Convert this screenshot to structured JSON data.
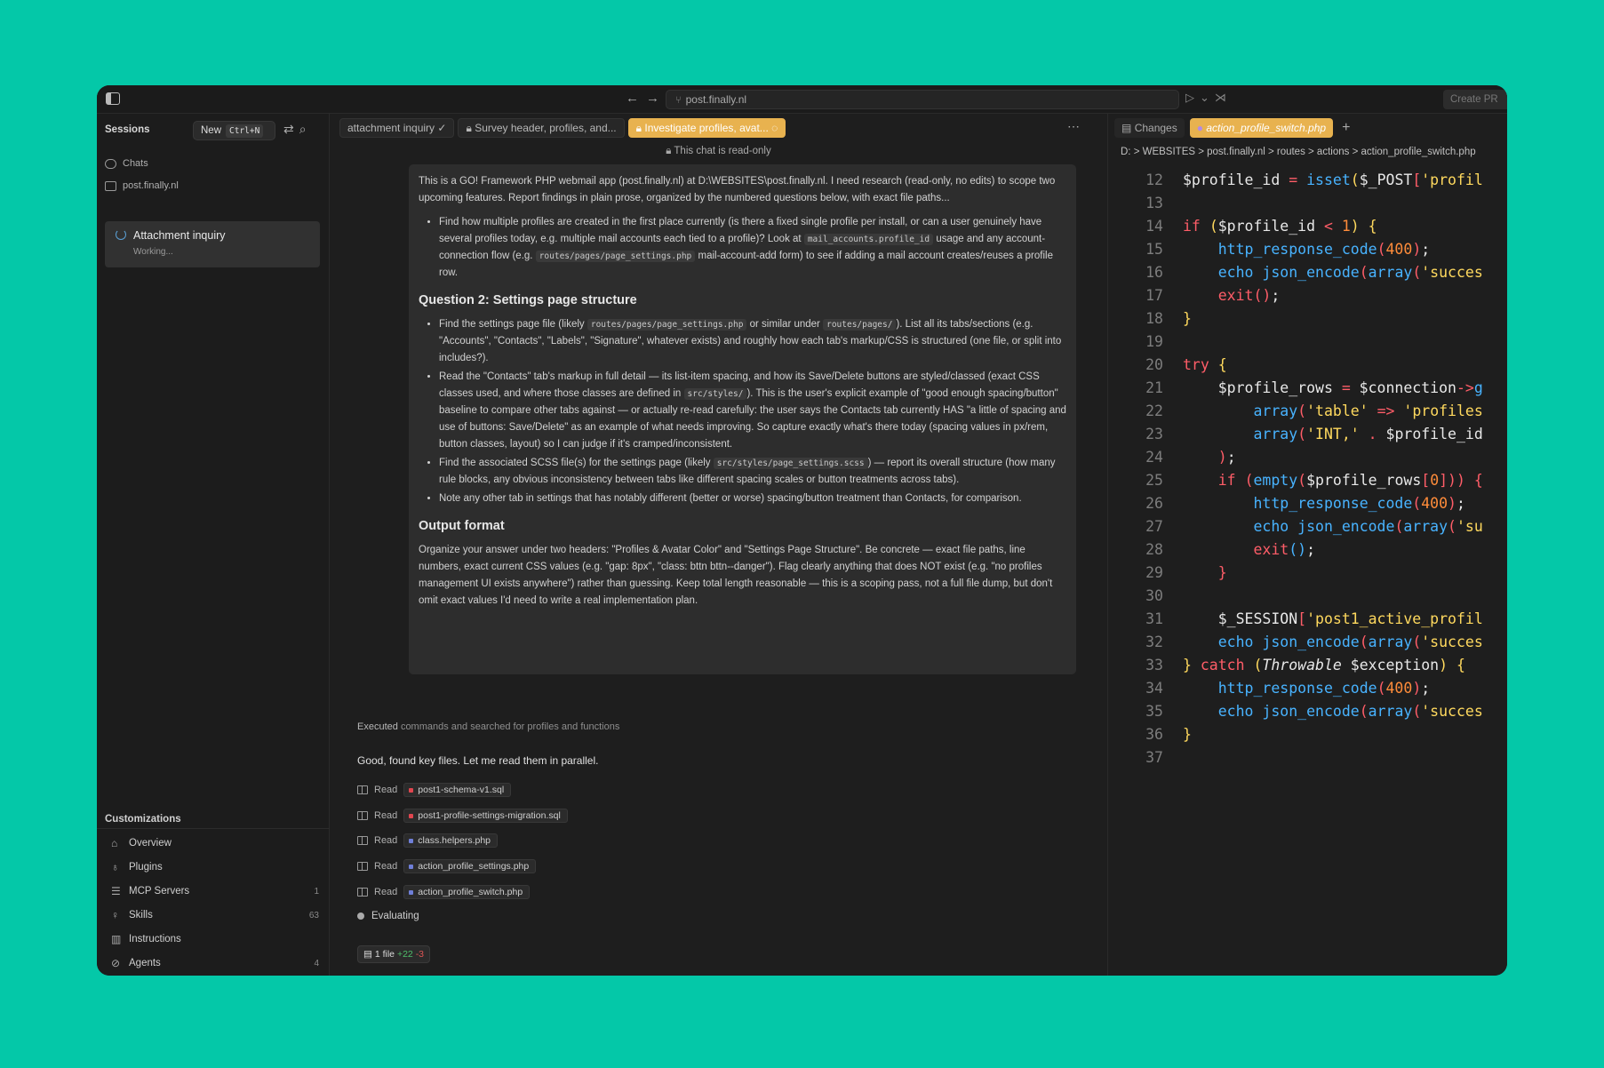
{
  "titlebar": {
    "url": "post.finally.nl",
    "create_pr": "Create PR"
  },
  "sidebar": {
    "title": "Sessions",
    "new_label": "New",
    "new_shortcut": "Ctrl+N",
    "chats": "Chats",
    "folder": "post.finally.nl",
    "session": {
      "title": "Attachment inquiry",
      "status": "Working..."
    },
    "customizations_title": "Customizations",
    "customizations": [
      {
        "label": "Overview",
        "icon": "home-icon",
        "count": ""
      },
      {
        "label": "Plugins",
        "icon": "plug-icon",
        "count": ""
      },
      {
        "label": "MCP Servers",
        "icon": "server-icon",
        "count": "1"
      },
      {
        "label": "Skills",
        "icon": "bulb-icon",
        "count": "63"
      },
      {
        "label": "Instructions",
        "icon": "book-icon",
        "count": ""
      },
      {
        "label": "Agents",
        "icon": "agent-icon",
        "count": "4"
      }
    ]
  },
  "chat": {
    "tabs": [
      "attachment inquiry",
      "Survey header, profiles, and...",
      "Investigate profiles, avat..."
    ],
    "readonly": "This chat is read-only",
    "intro": "This is a GO! Framework PHP webmail app (post.finally.nl) at D:\\WEBSITES\\post.finally.nl. I need research (read-only, no edits) to scope two upcoming features. Report findings in plain prose, organized by the numbered questions below, with exact file paths...",
    "q1_b1_a": "Find how multiple profiles are created in the first place currently (is there a fixed single profile per install, or can a user genuinely have several profiles today, e.g. multiple mail accounts each tied to a profile)? Look at",
    "q1_b1_code1": "mail_accounts.profile_id",
    "q1_b1_b": "usage and any account-connection flow (e.g.",
    "q1_b1_code2": "routes/pages/page_settings.php",
    "q1_b1_c": "mail-account-add form) to see if adding a mail account creates/reuses a profile row.",
    "q2_title": "Question 2: Settings page structure",
    "q2_b1_a": "Find the settings page file (likely",
    "q2_b1_code1": "routes/pages/page_settings.php",
    "q2_b1_b": "or similar under",
    "q2_b1_code2": "routes/pages/",
    "q2_b1_c": "). List all its tabs/sections (e.g. \"Accounts\", \"Contacts\", \"Labels\", \"Signature\", whatever exists) and roughly how each tab's markup/CSS is structured (one file, or split into includes?).",
    "q2_b2_a": "Read the \"Contacts\" tab's markup in full detail — its list-item spacing, and how its Save/Delete buttons are styled/classed (exact CSS classes used, and where those classes are defined in",
    "q2_b2_code": "src/styles/",
    "q2_b2_b": "). This is the user's explicit example of \"good enough spacing/button\" baseline to compare other tabs against — or actually re-read carefully: the user says the Contacts tab currently HAS \"a little of spacing and use of buttons: Save/Delete\" as an example of what needs improving. So capture exactly what's there today (spacing values in px/rem, button classes, layout) so I can judge if it's cramped/inconsistent.",
    "q2_b3_a": "Find the associated SCSS file(s) for the settings page (likely",
    "q2_b3_code": "src/styles/page_settings.scss",
    "q2_b3_b": ") — report its overall structure (how many rule blocks, any obvious inconsistency between tabs like different spacing scales or button treatments across tabs).",
    "q2_b4": "Note any other tab in settings that has notably different (better or worse) spacing/button treatment than Contacts, for comparison.",
    "out_title": "Output format",
    "out_text": "Organize your answer under two headers: \"Profiles & Avatar Color\" and \"Settings Page Structure\". Be concrete — exact file paths, line numbers, exact current CSS values (e.g. \"gap: 8px\", \"class: bttn bttn--danger\"). Flag clearly anything that does NOT exist (e.g. \"no profiles management UI exists anywhere\") rather than guessing. Keep total length reasonable — this is a scoping pass, not a full file dump, but don't omit exact values I'd need to write a real implementation plan.",
    "executed_a": "Executed",
    "executed_b": "commands and searched for profiles and functions",
    "good": "Good, found key files. Let me read them in parallel.",
    "read_label": "Read",
    "reads": [
      {
        "file": "post1-schema-v1.sql",
        "color": "#e0464f"
      },
      {
        "file": "post1-profile-settings-migration.sql",
        "color": "#e0464f"
      },
      {
        "file": "class.helpers.php",
        "color": "#6f7fd8"
      },
      {
        "file": "action_profile_settings.php",
        "color": "#6f7fd8"
      },
      {
        "file": "action_profile_switch.php",
        "color": "#6f7fd8"
      }
    ],
    "evaluating": "Evaluating",
    "files_chip": {
      "label": "1 file",
      "added": "+22",
      "removed": "-3"
    }
  },
  "editor": {
    "changes_tab": "Changes",
    "file_tab": "action_profile_switch.php",
    "breadcrumb": "D: > WEBSITES > post.finally.nl > routes > actions > action_profile_switch.php"
  },
  "colors": {
    "accent": "#e8b24f",
    "background": "#04c8a8"
  }
}
